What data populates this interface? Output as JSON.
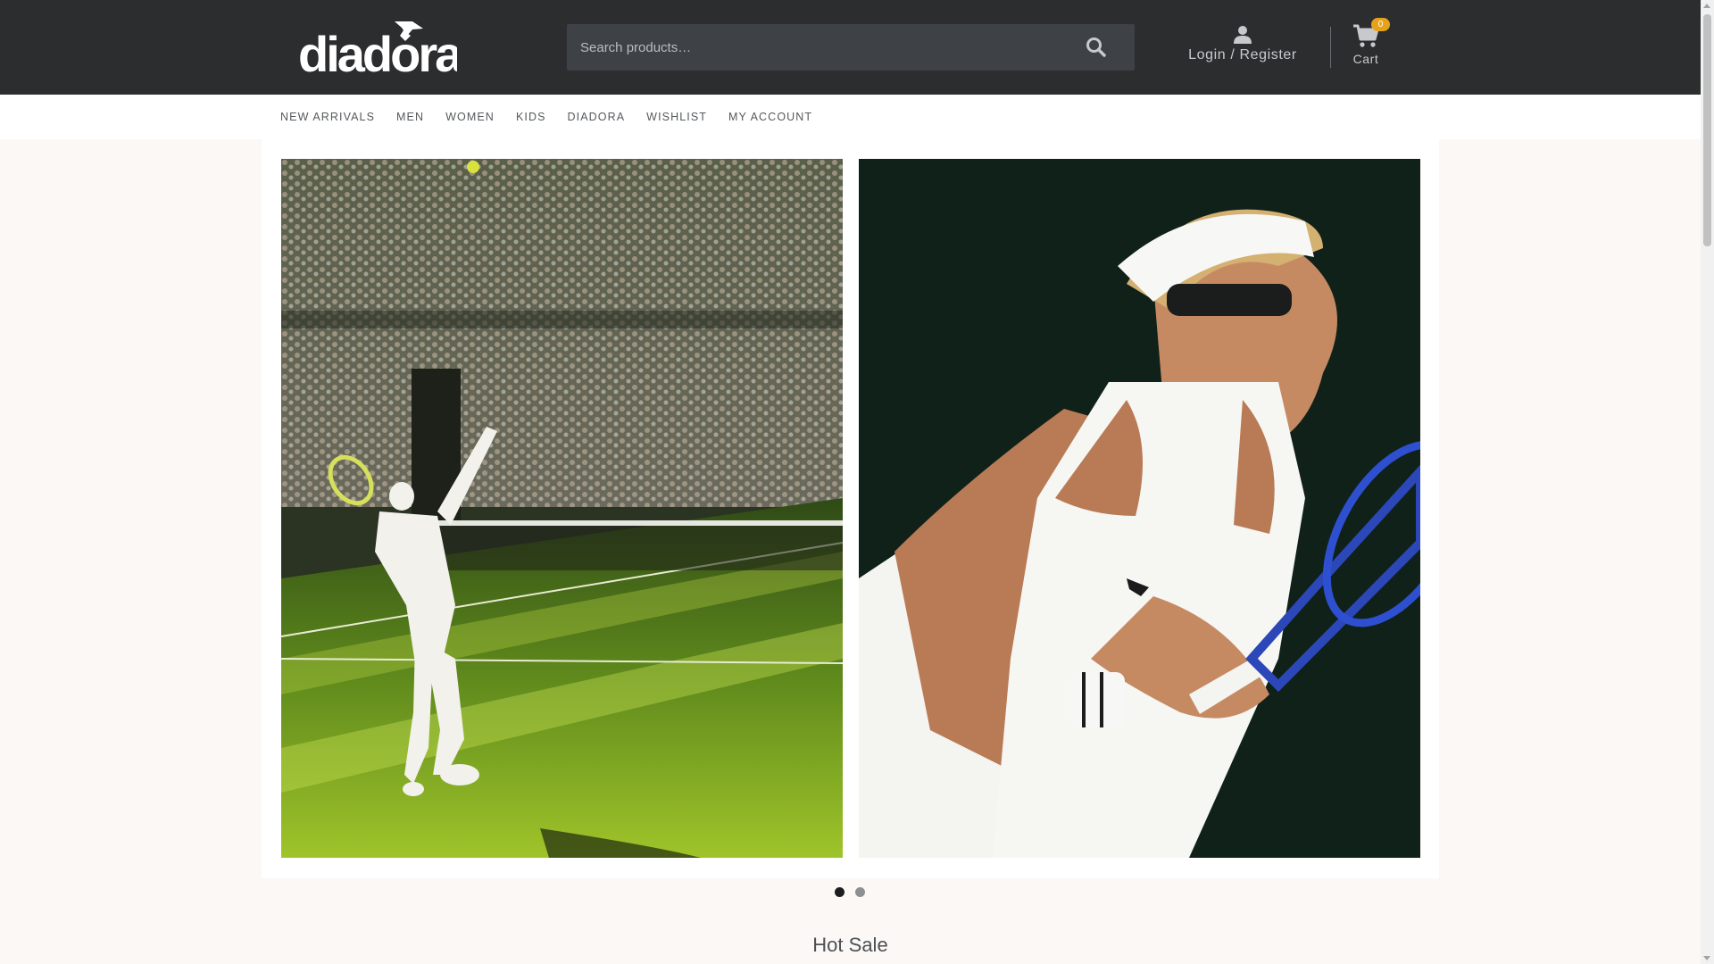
{
  "header": {
    "logo_text": "diadora",
    "search": {
      "placeholder": "Search products…"
    },
    "account": {
      "label": "Login / Register",
      "icon": "user-icon"
    },
    "cart": {
      "label": "Cart",
      "count": "0",
      "icon": "shopping-cart-icon"
    }
  },
  "nav": {
    "items": [
      {
        "label": "NEW ARRIVALS"
      },
      {
        "label": "MEN"
      },
      {
        "label": "WOMEN"
      },
      {
        "label": "KIDS"
      },
      {
        "label": "DIADORA"
      },
      {
        "label": "WISHLIST"
      },
      {
        "label": "MY ACCOUNT"
      }
    ]
  },
  "hero": {
    "slides": [
      {
        "subject": "male tennis player serving on grass court"
      },
      {
        "subject": "female tennis player in white visor and dress"
      }
    ],
    "pagination": {
      "total": 2,
      "active": 1
    }
  },
  "sections": {
    "hot_sale_title": "Hot Sale"
  },
  "colors": {
    "header_bg": "#2c2d2f",
    "search_bg": "#3e4145",
    "badge": "#e8a21a",
    "page_bg": "#fbf8f6"
  }
}
